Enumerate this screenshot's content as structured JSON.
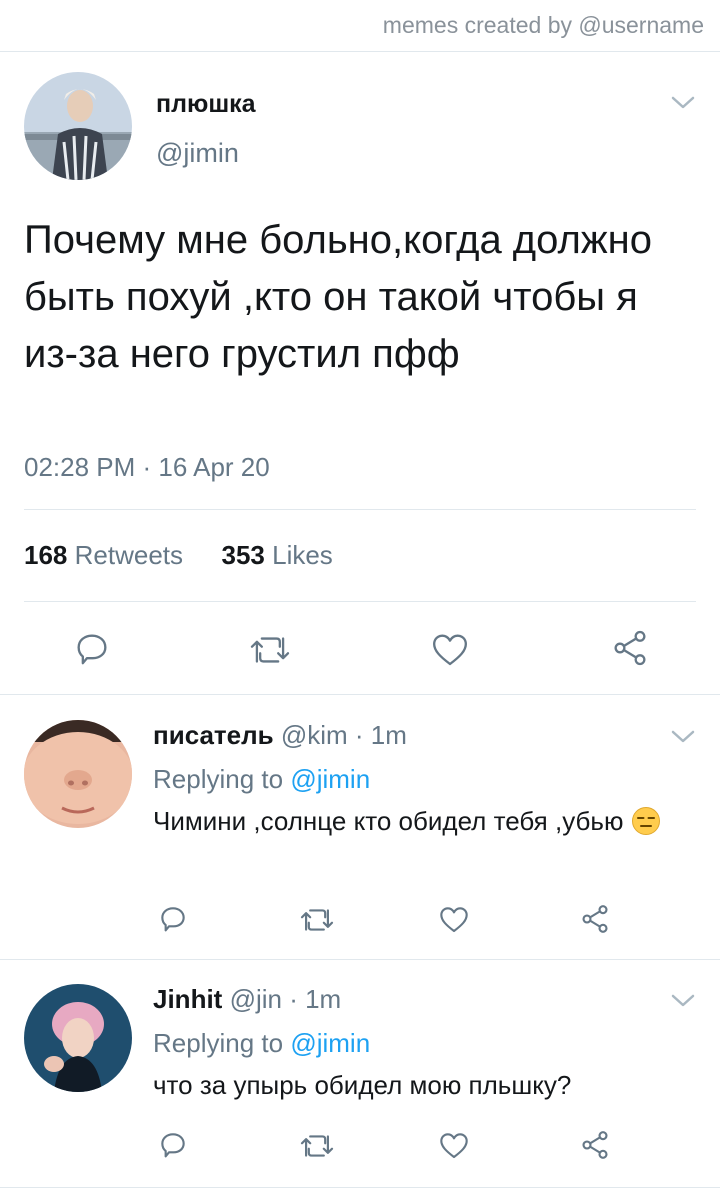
{
  "watermark": "memes created by @username",
  "main_tweet": {
    "name": "плюшка",
    "handle": "@jimin",
    "text": "Почему мне больно,когда должно быть похуй ,кто он такой чтобы я из-за него грустил пфф",
    "timestamp": "02:28 PM · 16 Apr 20",
    "retweets_count": "168",
    "retweets_label": "Retweets",
    "likes_count": "353",
    "likes_label": "Likes"
  },
  "replies": [
    {
      "name": "писатель",
      "meta": "@kim · 1m",
      "replying_prefix": "Replying to ",
      "replying_mention": "@jimin",
      "text": "Чимини ,солнце кто обидел тебя ,убью",
      "emoji": "expressionless-face-emoji"
    },
    {
      "name": "Jinhit",
      "meta": "@jin · 1m",
      "replying_prefix": "Replying to ",
      "replying_mention": "@jimin",
      "text": "что за упырь обидел мою пльшку?"
    }
  ],
  "colors": {
    "text": "#14171a",
    "secondary": "#657786",
    "link": "#1da1f2",
    "divider": "#e1e8ed",
    "icon": "#657786"
  }
}
